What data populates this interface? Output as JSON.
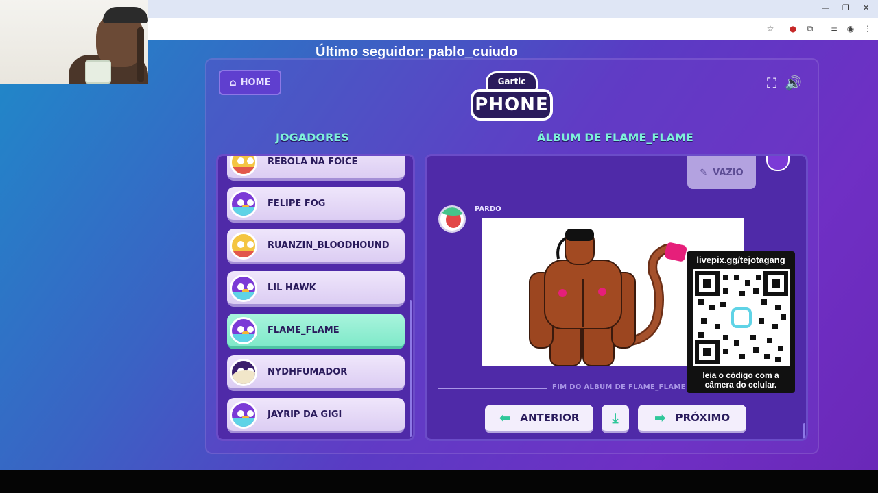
{
  "stream": {
    "last_follower": "Último seguidor: pablo_cuiudo",
    "qr_url": "livepix.gg/tejotagang",
    "qr_caption_line1": "leia o código com a",
    "qr_caption_line2": "câmera do celular."
  },
  "game": {
    "home_label": "HOME",
    "logo_top": "Gartic",
    "logo_main": "PHONE",
    "players_heading": "JOGADORES",
    "album_heading": "ÁLBUM DE FLAME_FLAME",
    "players": [
      {
        "name": "REBOLA NA FOICE",
        "avatar": "pizza",
        "active": false
      },
      {
        "name": "FELIPE FOG",
        "avatar": "bird",
        "active": false
      },
      {
        "name": "RUANZIN_BLOODHOUND",
        "avatar": "pizza",
        "active": false
      },
      {
        "name": "LIL HAWK",
        "avatar": "bird",
        "active": false
      },
      {
        "name": "FLAME_FLAME",
        "avatar": "bird",
        "active": true
      },
      {
        "name": "NYDHFUMADOR",
        "avatar": "skull",
        "active": false
      },
      {
        "name": "JAYRIP DA GIGI",
        "avatar": "bird",
        "active": false
      }
    ],
    "album": {
      "vazio_label": "VAZIO",
      "author_label": "PARDO",
      "end_label": "FIM DO ÁLBUM DE FLAME_FLAME"
    },
    "buttons": {
      "previous": "ANTERIOR",
      "next": "PRÓXIMO"
    }
  },
  "colors": {
    "accent_green": "#7ef0d9",
    "panel_purple": "#4f2aa8",
    "active_player": "#7fe9c9"
  }
}
